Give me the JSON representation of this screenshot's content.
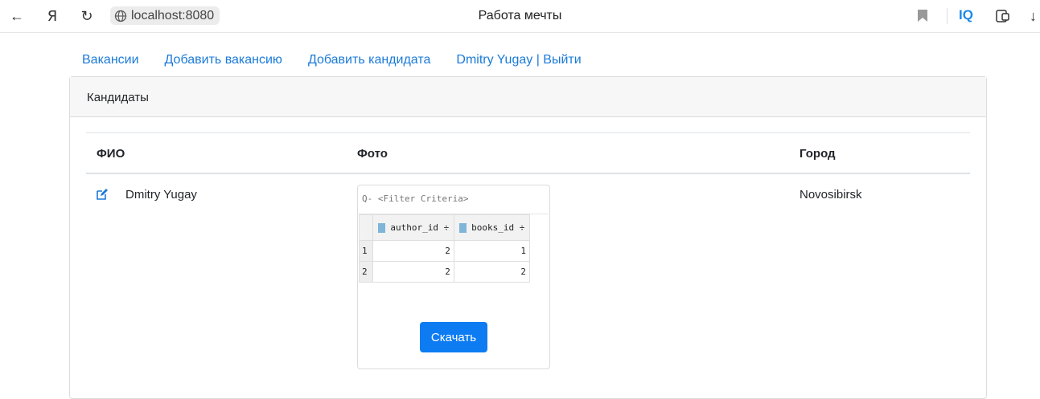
{
  "browser": {
    "url": "localhost:8080",
    "title": "Работа мечты",
    "extension_label": "IQ",
    "back_icon": "←",
    "yandex_icon": "Я",
    "reload_icon": "↻",
    "download_icon": "↓"
  },
  "nav": {
    "items": [
      {
        "label": "Вакансии"
      },
      {
        "label": "Добавить вакансию"
      },
      {
        "label": "Добавить кандидата"
      },
      {
        "label": "Dmitry Yugay | Выйти"
      }
    ]
  },
  "card": {
    "header": "Кандидаты",
    "columns": [
      "ФИО",
      "Фото",
      "Город"
    ],
    "rows": [
      {
        "name": "Dmitry Yugay",
        "city": "Novosibirsk",
        "photo": {
          "filter_placeholder": "Q- <Filter Criteria>",
          "columns": [
            "author_id ÷",
            "books_id ÷"
          ],
          "rows": [
            {
              "n": "1",
              "author_id": "2",
              "books_id": "1"
            },
            {
              "n": "2",
              "author_id": "2",
              "books_id": "2"
            }
          ]
        },
        "download_label": "Скачать"
      }
    ]
  },
  "colors": {
    "link": "#1a7ad8",
    "button": "#0d7cf2",
    "header_bg": "#f7f7f7"
  }
}
